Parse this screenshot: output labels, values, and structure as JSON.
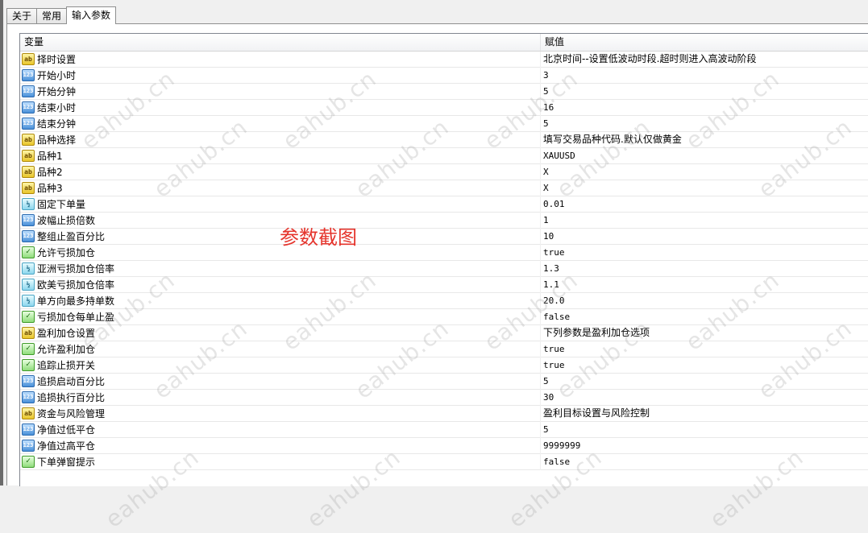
{
  "tabs": [
    {
      "label": "关于",
      "active": false
    },
    {
      "label": "常用",
      "active": false
    },
    {
      "label": "输入参数",
      "active": true
    }
  ],
  "table": {
    "headers": {
      "name": "变量",
      "value": "赋值"
    },
    "rows": [
      {
        "type": "ab",
        "icon": "string-type-icon",
        "name": "择时设置",
        "value": "北京时间--设置低波动时段.超时则进入高波动阶段",
        "mono": false
      },
      {
        "type": "int",
        "icon": "integer-type-icon",
        "name": "开始小时",
        "value": "3",
        "mono": true
      },
      {
        "type": "int",
        "icon": "integer-type-icon",
        "name": "开始分钟",
        "value": "5",
        "mono": true
      },
      {
        "type": "int",
        "icon": "integer-type-icon",
        "name": "结束小时",
        "value": "16",
        "mono": true
      },
      {
        "type": "int",
        "icon": "integer-type-icon",
        "name": "结束分钟",
        "value": "5",
        "mono": true
      },
      {
        "type": "ab",
        "icon": "string-type-icon",
        "name": "品种选择",
        "value": "填写交易品种代码.默认仅做黄金",
        "mono": false
      },
      {
        "type": "ab",
        "icon": "string-type-icon",
        "name": "品种1",
        "value": "XAUUSD",
        "mono": true
      },
      {
        "type": "ab",
        "icon": "string-type-icon",
        "name": "品种2",
        "value": "X",
        "mono": true
      },
      {
        "type": "ab",
        "icon": "string-type-icon",
        "name": "品种3",
        "value": "X",
        "mono": true
      },
      {
        "type": "dbl",
        "icon": "double-type-icon",
        "name": "固定下单量",
        "value": "0.01",
        "mono": true
      },
      {
        "type": "int",
        "icon": "integer-type-icon",
        "name": "波幅止损倍数",
        "value": "1",
        "mono": true
      },
      {
        "type": "int",
        "icon": "integer-type-icon",
        "name": "整组止盈百分比",
        "value": "10",
        "mono": true
      },
      {
        "type": "bool",
        "icon": "boolean-type-icon",
        "name": "允许亏损加仓",
        "value": "true",
        "mono": true
      },
      {
        "type": "dbl",
        "icon": "double-type-icon",
        "name": "亚洲亏损加仓倍率",
        "value": "1.3",
        "mono": true
      },
      {
        "type": "dbl",
        "icon": "double-type-icon",
        "name": "欧美亏损加仓倍率",
        "value": "1.1",
        "mono": true
      },
      {
        "type": "dbl",
        "icon": "double-type-icon",
        "name": "单方向最多持单数",
        "value": "20.0",
        "mono": true
      },
      {
        "type": "bool",
        "icon": "boolean-type-icon",
        "name": "亏损加仓每单止盈",
        "value": "false",
        "mono": true
      },
      {
        "type": "ab",
        "icon": "string-type-icon",
        "name": "盈利加仓设置",
        "value": "下列参数是盈利加仓选项",
        "mono": false
      },
      {
        "type": "bool",
        "icon": "boolean-type-icon",
        "name": "允许盈利加仓",
        "value": "true",
        "mono": true
      },
      {
        "type": "bool",
        "icon": "boolean-type-icon",
        "name": "追踪止损开关",
        "value": "true",
        "mono": true
      },
      {
        "type": "int",
        "icon": "integer-type-icon",
        "name": "追损启动百分比",
        "value": "5",
        "mono": true
      },
      {
        "type": "int",
        "icon": "integer-type-icon",
        "name": "追损执行百分比",
        "value": "30",
        "mono": true
      },
      {
        "type": "ab",
        "icon": "string-type-icon",
        "name": "资金与风险管理",
        "value": "盈利目标设置与风险控制",
        "mono": false
      },
      {
        "type": "int",
        "icon": "integer-type-icon",
        "name": "净值过低平仓",
        "value": "5",
        "mono": true
      },
      {
        "type": "int",
        "icon": "integer-type-icon",
        "name": "净值过高平仓",
        "value": "9999999",
        "mono": true
      },
      {
        "type": "bool",
        "icon": "boolean-type-icon",
        "name": "下单弹窗提示",
        "value": "false",
        "mono": true
      }
    ]
  },
  "icon_glyphs": {
    "ab": "ab",
    "int": "123",
    "dbl": "½",
    "bool": "✓"
  },
  "annotation": "参数截图",
  "watermark": "eahub.cn"
}
